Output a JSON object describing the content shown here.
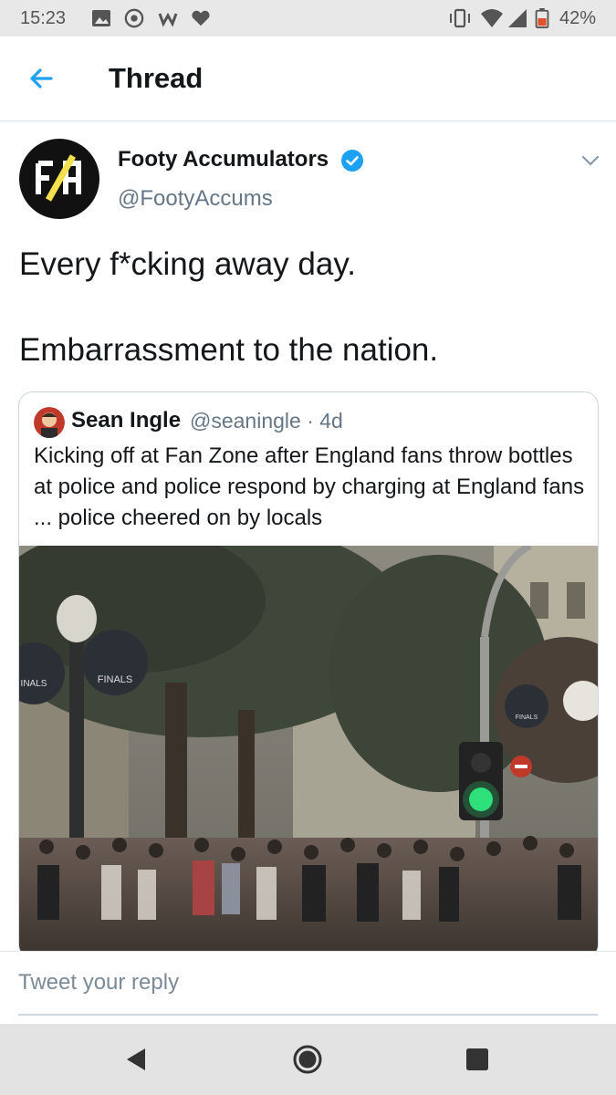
{
  "status_bar": {
    "time": "15:23",
    "battery": "42%",
    "icons": [
      "gallery-icon",
      "whatsapp-icon",
      "w-icon",
      "heart-icon",
      "vibrate-icon",
      "wifi-icon",
      "signal-icon",
      "battery-icon"
    ]
  },
  "app_bar": {
    "title": "Thread",
    "back_icon": "arrow-left-icon"
  },
  "tweet": {
    "avatar_text": "F/A",
    "display_name": "Footy Accumulators",
    "handle": "@FootyAccums",
    "verified": true,
    "text": "Every f*cking away day.\n\nEmbarrassment to the nation."
  },
  "quoted_tweet": {
    "display_name": "Sean Ingle",
    "meta": "@seaningle · 4d",
    "text": "Kicking off at Fan Zone after England fans throw bottles at police and police respond by charging at England fans ... police cheered on by locals",
    "media": {
      "sign_left": "INALS",
      "sign_center": "FINALS",
      "sign_right": "FINALS"
    }
  },
  "reply": {
    "placeholder": "Tweet your reply"
  },
  "colors": {
    "accent": "#1da1f2",
    "text": "#14171a",
    "secondary": "#657786",
    "border": "#e1e8ed"
  }
}
